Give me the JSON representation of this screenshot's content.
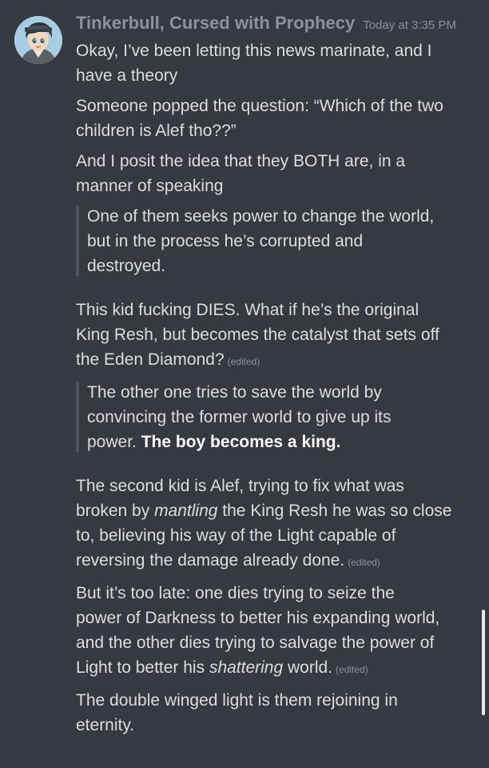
{
  "message": {
    "username": "Tinkerbull, Cursed with Prophecy",
    "timestamp": "Today at 3:35 PM",
    "edited_label": "(edited)",
    "avatar_icon": "user-avatar-icon",
    "p1": [
      "Okay, I’ve been letting this news marinate, and I",
      "have a theory"
    ],
    "p2": [
      "Someone popped the question: “Which of the two",
      "children is Alef tho??”"
    ],
    "p3": [
      "And I posit the idea that they BOTH are, in a",
      "manner of speaking"
    ],
    "quote1": [
      "One of them seeks power to change the world,",
      "but in the process he’s corrupted and",
      "destroyed."
    ],
    "p4": [
      "This kid fucking DIES. What if he’s the original",
      "King Resh, but becomes the catalyst that sets off",
      "the Eden Diamond?"
    ],
    "quote2": {
      "lines": [
        "The other one tries to save the world by",
        "convincing the former world to give up its"
      ],
      "last_prefix": "power. ",
      "last_bold": "The boy becomes a king."
    },
    "p5": {
      "line1": "The second kid is Alef, trying to fix what was",
      "line2_pre": "broken by ",
      "line2_italic": "mantling",
      "line2_post": " the King Resh he was so close",
      "line3": "to, believing his way of the Light capable of",
      "line4": "reversing the damage already done."
    },
    "p6": {
      "line1": "But it’s too late: one dies trying to seize the",
      "line2": "power of Darkness to better his expanding world,",
      "line3": "and the other dies trying to salvage the power of",
      "line4_pre": "Light to better his ",
      "line4_italic": "shattering",
      "line4_post": " world."
    },
    "p7": [
      "The double winged light is them rejoining in",
      "eternity."
    ]
  },
  "colors": {
    "background": "#36393f",
    "text": "#dcddde",
    "muted": "#8e9297",
    "quote_bar": "#4f545c"
  }
}
